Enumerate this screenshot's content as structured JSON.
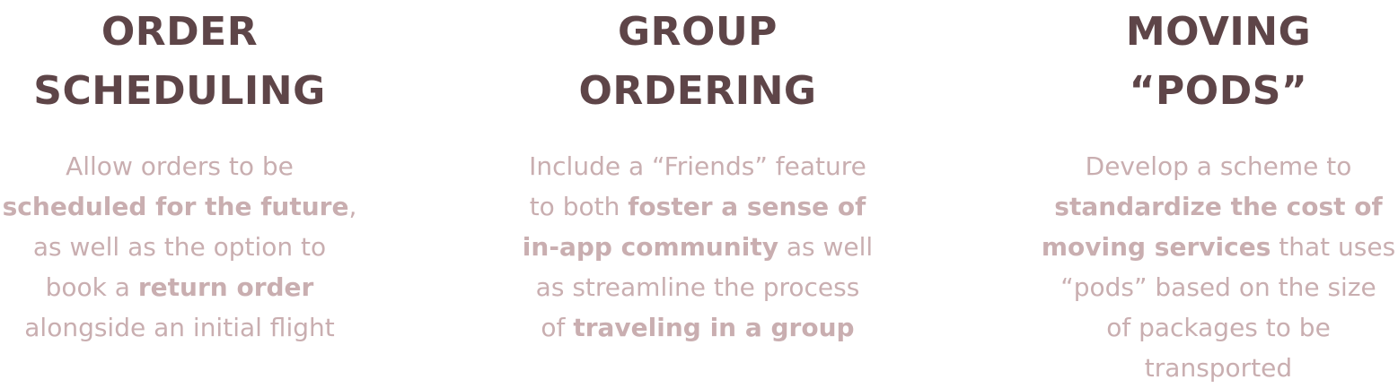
{
  "features": [
    {
      "title": [
        "ORDER",
        "SCHEDULING"
      ],
      "description": [
        [
          {
            "t": "Allow orders to be",
            "b": false
          }
        ],
        [
          {
            "t": "scheduled for the future",
            "b": true
          },
          {
            "t": ",",
            "b": false
          }
        ],
        [
          {
            "t": "as well as the option to",
            "b": false
          }
        ],
        [
          {
            "t": "book a ",
            "b": false
          },
          {
            "t": "return order",
            "b": true
          }
        ],
        [
          {
            "t": "alongside an initial flight",
            "b": false
          }
        ]
      ]
    },
    {
      "title": [
        "GROUP",
        "ORDERING"
      ],
      "description": [
        [
          {
            "t": "Include a “Friends” feature",
            "b": false
          }
        ],
        [
          {
            "t": "to both ",
            "b": false
          },
          {
            "t": "foster a sense of",
            "b": true
          }
        ],
        [
          {
            "t": "in-app community",
            "b": true
          },
          {
            "t": " as well",
            "b": false
          }
        ],
        [
          {
            "t": "as streamline the process",
            "b": false
          }
        ],
        [
          {
            "t": "of ",
            "b": false
          },
          {
            "t": "traveling in a group",
            "b": true
          }
        ]
      ]
    },
    {
      "title": [
        "MOVING",
        "“PODS”"
      ],
      "description": [
        [
          {
            "t": "Develop a scheme to",
            "b": false
          }
        ],
        [
          {
            "t": "standardize the cost of",
            "b": true
          }
        ],
        [
          {
            "t": "moving services",
            "b": true
          },
          {
            "t": " that uses",
            "b": false
          }
        ],
        [
          {
            "t": "“pods” based on the size",
            "b": false
          }
        ],
        [
          {
            "t": "of packages to be",
            "b": false
          }
        ],
        [
          {
            "t": "transported",
            "b": false
          }
        ]
      ]
    }
  ],
  "colors": {
    "title": "#5e4548",
    "body": "#c9aeb0"
  }
}
